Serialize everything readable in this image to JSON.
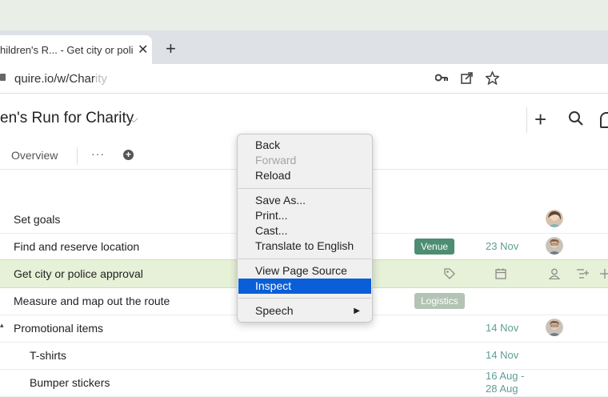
{
  "browser": {
    "tab_title": "hildren's R... - Get city or poli",
    "tab_close": "✕",
    "new_tab": "+",
    "url_visible": "quire.io/w/Char",
    "url_faded": "ity",
    "toolbar_icons": [
      "key-icon",
      "open-external-icon",
      "star-icon"
    ]
  },
  "app": {
    "project_title": "en's Run for Charity",
    "title_chevron": "⌵",
    "add_symbol": "+",
    "nav": {
      "overview": "Overview",
      "more": "···",
      "add": "+"
    }
  },
  "tasks": [
    {
      "name": "Set goals",
      "tag": "",
      "date": "",
      "avatar": "female"
    },
    {
      "name": "Find and reserve location",
      "tag": "Venue",
      "tag_color": "#4e8d74",
      "date": "23 Nov",
      "avatar": "male"
    },
    {
      "name": "Get city or police approval",
      "tag": "",
      "date": "",
      "avatar": "",
      "highlighted": true
    },
    {
      "name": "Measure and map out the route",
      "tag": "Logistics",
      "tag_color": "#b3c3b4",
      "date": "",
      "avatar": ""
    },
    {
      "name": "Promotional items",
      "tag": "",
      "date": "14 Nov",
      "avatar": "male",
      "expanded": true,
      "caret": "▴"
    },
    {
      "name": "T-shirts",
      "tag": "",
      "date": "14 Nov",
      "avatar": "",
      "indent": true
    },
    {
      "name": "Bumper stickers",
      "tag": "",
      "date_line1": "16 Aug -",
      "date_line2": "28 Aug",
      "avatar": "",
      "indent": true
    }
  ],
  "context_menu": {
    "items": [
      {
        "label": "Back",
        "state": "normal"
      },
      {
        "label": "Forward",
        "state": "disabled"
      },
      {
        "label": "Reload",
        "state": "normal"
      },
      {
        "label": "Save As...",
        "state": "normal"
      },
      {
        "label": "Print...",
        "state": "normal"
      },
      {
        "label": "Cast...",
        "state": "normal"
      },
      {
        "label": "Translate to English",
        "state": "normal"
      },
      {
        "label": "View Page Source",
        "state": "normal"
      },
      {
        "label": "Inspect",
        "state": "selected"
      },
      {
        "label": "Speech",
        "state": "normal",
        "submenu_arrow": "▶"
      }
    ]
  },
  "colors": {
    "accent_green": "#4e8d74",
    "date_teal": "#5f9d93",
    "menu_selection": "#0a5ed7",
    "row_highlight": "#e6f1d8"
  }
}
